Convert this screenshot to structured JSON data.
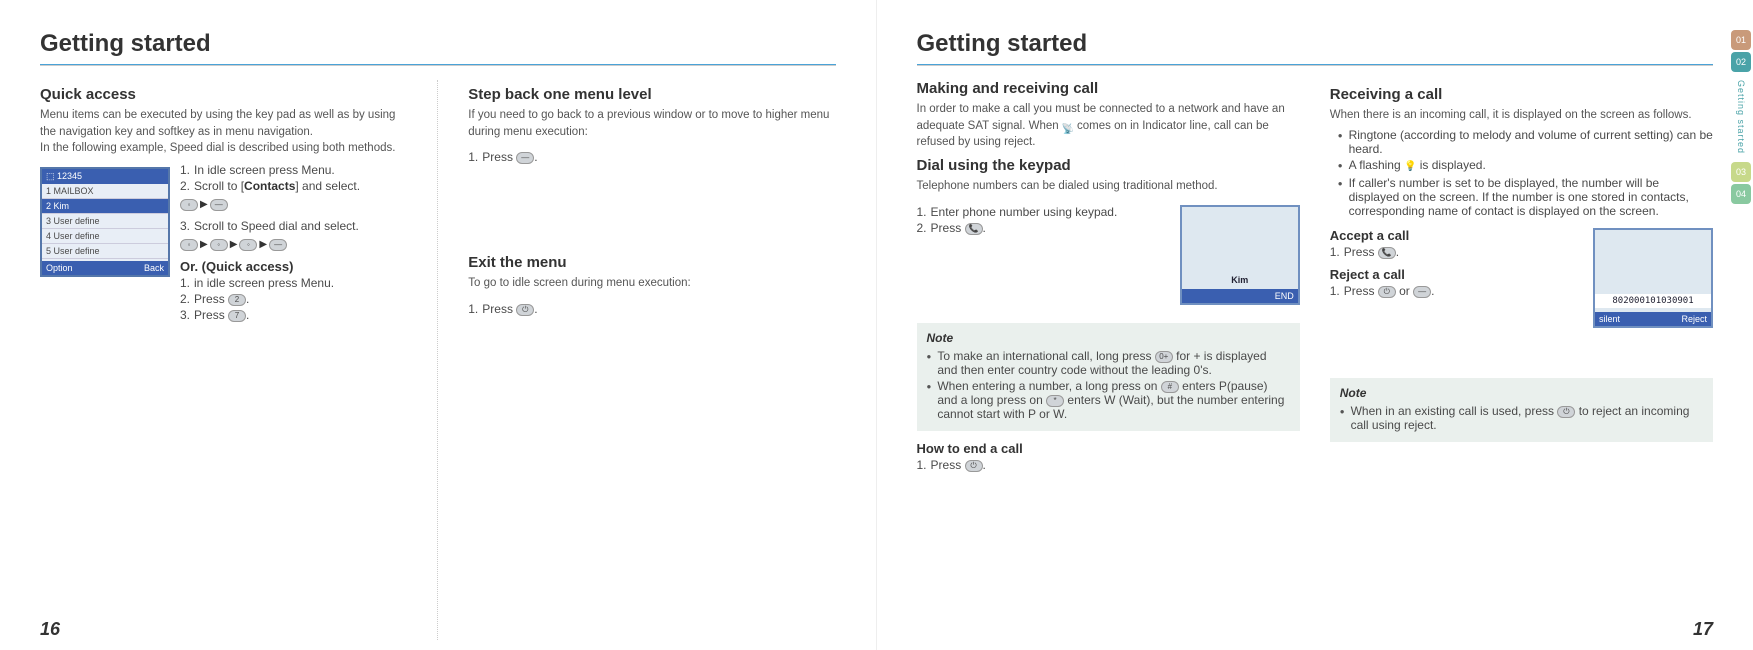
{
  "left": {
    "title": "Getting started",
    "quick_access": {
      "heading": "Quick access",
      "intro1": "Menu items can be executed by using the key pad as well as by using the navigation key and softkey as in menu navigation.",
      "intro2": "In the following example, Speed dial is described using both methods.",
      "steps": {
        "s1_num": "1.",
        "s1": "In idle screen press Menu.",
        "s2_num": "2.",
        "s2_pre": "Scroll to [",
        "s2_bold": "Contacts",
        "s2_post": "] and select.",
        "s3_num": "3.",
        "s3": "Scroll to Speed dial and select."
      },
      "or_heading": "Or. (Quick access)",
      "or_steps": {
        "o1_num": "1.",
        "o1": "in idle screen press Menu.",
        "o2_num": "2.",
        "o2_pre": "Press ",
        "o2_key": "2",
        "o2_post": ".",
        "o3_num": "3.",
        "o3_pre": "Press ",
        "o3_key": "7",
        "o3_post": "."
      },
      "screen": {
        "header": "⬚ 12345",
        "r1": "1 MAILBOX",
        "r2": "2 Kim",
        "r3": "3 User define",
        "r4": "4 User define",
        "r5": "5 User define",
        "footL": "Option",
        "footR": "Back"
      }
    },
    "step_back": {
      "heading": "Step back one menu level",
      "intro": "If you need to go back to a previous window or to move to higher menu during menu execution:",
      "s1_num": "1.",
      "s1_pre": "Press ",
      "s1_post": "."
    },
    "exit_menu": {
      "heading": "Exit the menu",
      "intro": "To go to idle screen during menu execution:",
      "s1_num": "1.",
      "s1_pre": "Press ",
      "s1_post": "."
    },
    "page_num": "16"
  },
  "right": {
    "title": "Getting started",
    "making": {
      "heading": "Making and receiving call",
      "intro_pre": "In order to make a call you must be connected to a network and have an adequate SAT signal. When ",
      "intro_post": " comes on in Indicator line, call can be refused by using reject."
    },
    "dial": {
      "heading": "Dial using the keypad",
      "intro": "Telephone numbers can be dialed using traditional method.",
      "s1_num": "1.",
      "s1": "Enter phone number using keypad.",
      "s2_num": "2.",
      "s2_pre": "Press ",
      "s2_post": ".",
      "screen_name": "Kim",
      "screen_end": "END"
    },
    "note1": {
      "title": "Note",
      "b1_pre": "To make an international call, long press ",
      "b1_mid": " for + is displayed and then enter country code without the leading 0's.",
      "b2_pre": "When entering a number, a long press on ",
      "b2_mid": " enters P(pause) and a long press on ",
      "b2_post": " enters W (Wait), but the number entering cannot start with P or W."
    },
    "end_call": {
      "heading": "How to end a call",
      "s1_num": "1.",
      "s1_pre": "Press ",
      "s1_post": "."
    },
    "receiving": {
      "heading": "Receiving a call",
      "intro": "When there is an incoming call, it is displayed on the screen as follows.",
      "b1": "Ringtone (according to melody and volume of current setting) can be heard.",
      "b2_pre": "A flashing ",
      "b2_post": " is displayed.",
      "b3": "If caller's number is set to be displayed, the number will be displayed on the screen. If the number is one stored in contacts, corresponding name of contact is displayed on the screen."
    },
    "accept": {
      "heading": "Accept a call",
      "s1_num": "1.",
      "s1_pre": "Press ",
      "s1_post": "."
    },
    "reject": {
      "heading": "Reject a call",
      "s1_num": "1.",
      "s1_pre": "Press ",
      "s1_mid": " or ",
      "s1_post": ".",
      "screen_num": "802000101030901",
      "screen_l": "silent",
      "screen_r": "Reject"
    },
    "note2": {
      "title": "Note",
      "b1_pre": "When in an existing call is used, press ",
      "b1_post": " to reject an incoming call using reject."
    },
    "page_num": "17",
    "tabs": {
      "t1": "01",
      "t2": "02",
      "t3": "03",
      "t4": "04",
      "label": "Getting started"
    }
  }
}
